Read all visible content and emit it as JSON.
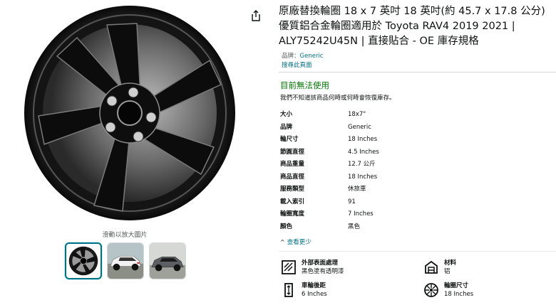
{
  "gallery": {
    "hint": "滑動以放大圖片",
    "thumbnails": [
      "wheel",
      "white-suv",
      "gray-suv"
    ]
  },
  "product": {
    "title": "原廠替換輪圈 18 x 7 英吋 18 英吋(約 45.7 x 17.8 公分)優質鋁合金輪圈適用於 Toyota RAV4 2019 2021 | ALY75242U45N | 直接貼合 - OE 庫存規格",
    "brand_label": "品牌：",
    "brand_value": "Generic",
    "search_link": "搜尋此頁面"
  },
  "availability": {
    "status": "目前無法使用",
    "note": "我們不知道該商品何時或何時會恢復庫存。"
  },
  "specs": [
    {
      "key": "大小",
      "value": "18x7\""
    },
    {
      "key": "品牌",
      "value": "Generic"
    },
    {
      "key": "輪尺寸",
      "value": "18 Inches"
    },
    {
      "key": "節圓直徑",
      "value": "4.5 Inches"
    },
    {
      "key": "商品重量",
      "value": "12.7 公斤"
    },
    {
      "key": "商品直徑",
      "value": "18 Inches"
    },
    {
      "key": "服務類型",
      "value": "休旅車"
    },
    {
      "key": "載入索引",
      "value": "91"
    },
    {
      "key": "輪圈寬度",
      "value": "7 Inches"
    },
    {
      "key": "顏色",
      "value": "黑色"
    }
  ],
  "see_less": "查看更少",
  "features": [
    {
      "label": "外部表面處理",
      "value": "黑色塗有透明漆",
      "icon": "surface-finish-icon"
    },
    {
      "label": "材料",
      "value": "铝",
      "icon": "material-icon"
    },
    {
      "label": "車輪後距",
      "value": "6 Inches",
      "icon": "backspacing-icon"
    },
    {
      "label": "輪圈尺寸",
      "value": "18 Inches",
      "icon": "rim-size-icon"
    }
  ]
}
